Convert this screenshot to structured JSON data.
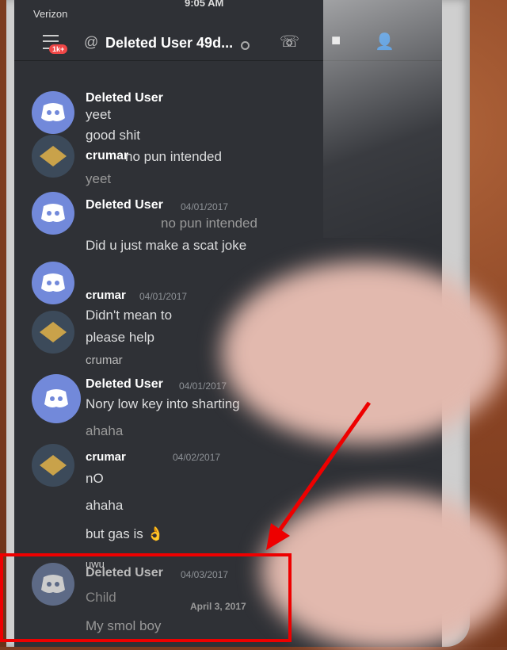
{
  "status_bar": {
    "carrier": "Verizon",
    "time": "9:05 AM"
  },
  "header": {
    "badge": "1k+",
    "title": "Deleted User 49d..."
  },
  "messages": [
    {
      "author": "Deleted User",
      "time": "",
      "lines": [
        "yeet",
        "good shit"
      ],
      "avatar": "discord"
    },
    {
      "author": "crumar",
      "time": "",
      "lines": [
        "no pun intended",
        "yeet"
      ],
      "avatar": "user"
    },
    {
      "author": "Deleted User",
      "time": "04/01/2017",
      "lines": [
        "no pun intended",
        "Did u just make a scat joke"
      ],
      "avatar": "discord"
    },
    {
      "author": "crumar",
      "time": "04/01/2017",
      "lines": [
        "Didn't mean to",
        "please help",
        "crumar"
      ],
      "avatar": "user"
    },
    {
      "author": "Deleted User",
      "time": "04/01/2017",
      "lines": [
        "Nory low key into sharting",
        "ahaha"
      ],
      "avatar": "discord"
    },
    {
      "author": "crumar",
      "time": "04/02/2017",
      "lines": [
        "nO",
        "ahaha",
        "but gas is 👌",
        "uwu"
      ],
      "avatar": "user"
    },
    {
      "author": "Deleted User",
      "time": "04/03/2017",
      "lines": [
        "Child",
        "My smol boy"
      ],
      "avatar": "discord"
    }
  ],
  "date_divider": "April 3, 2017"
}
